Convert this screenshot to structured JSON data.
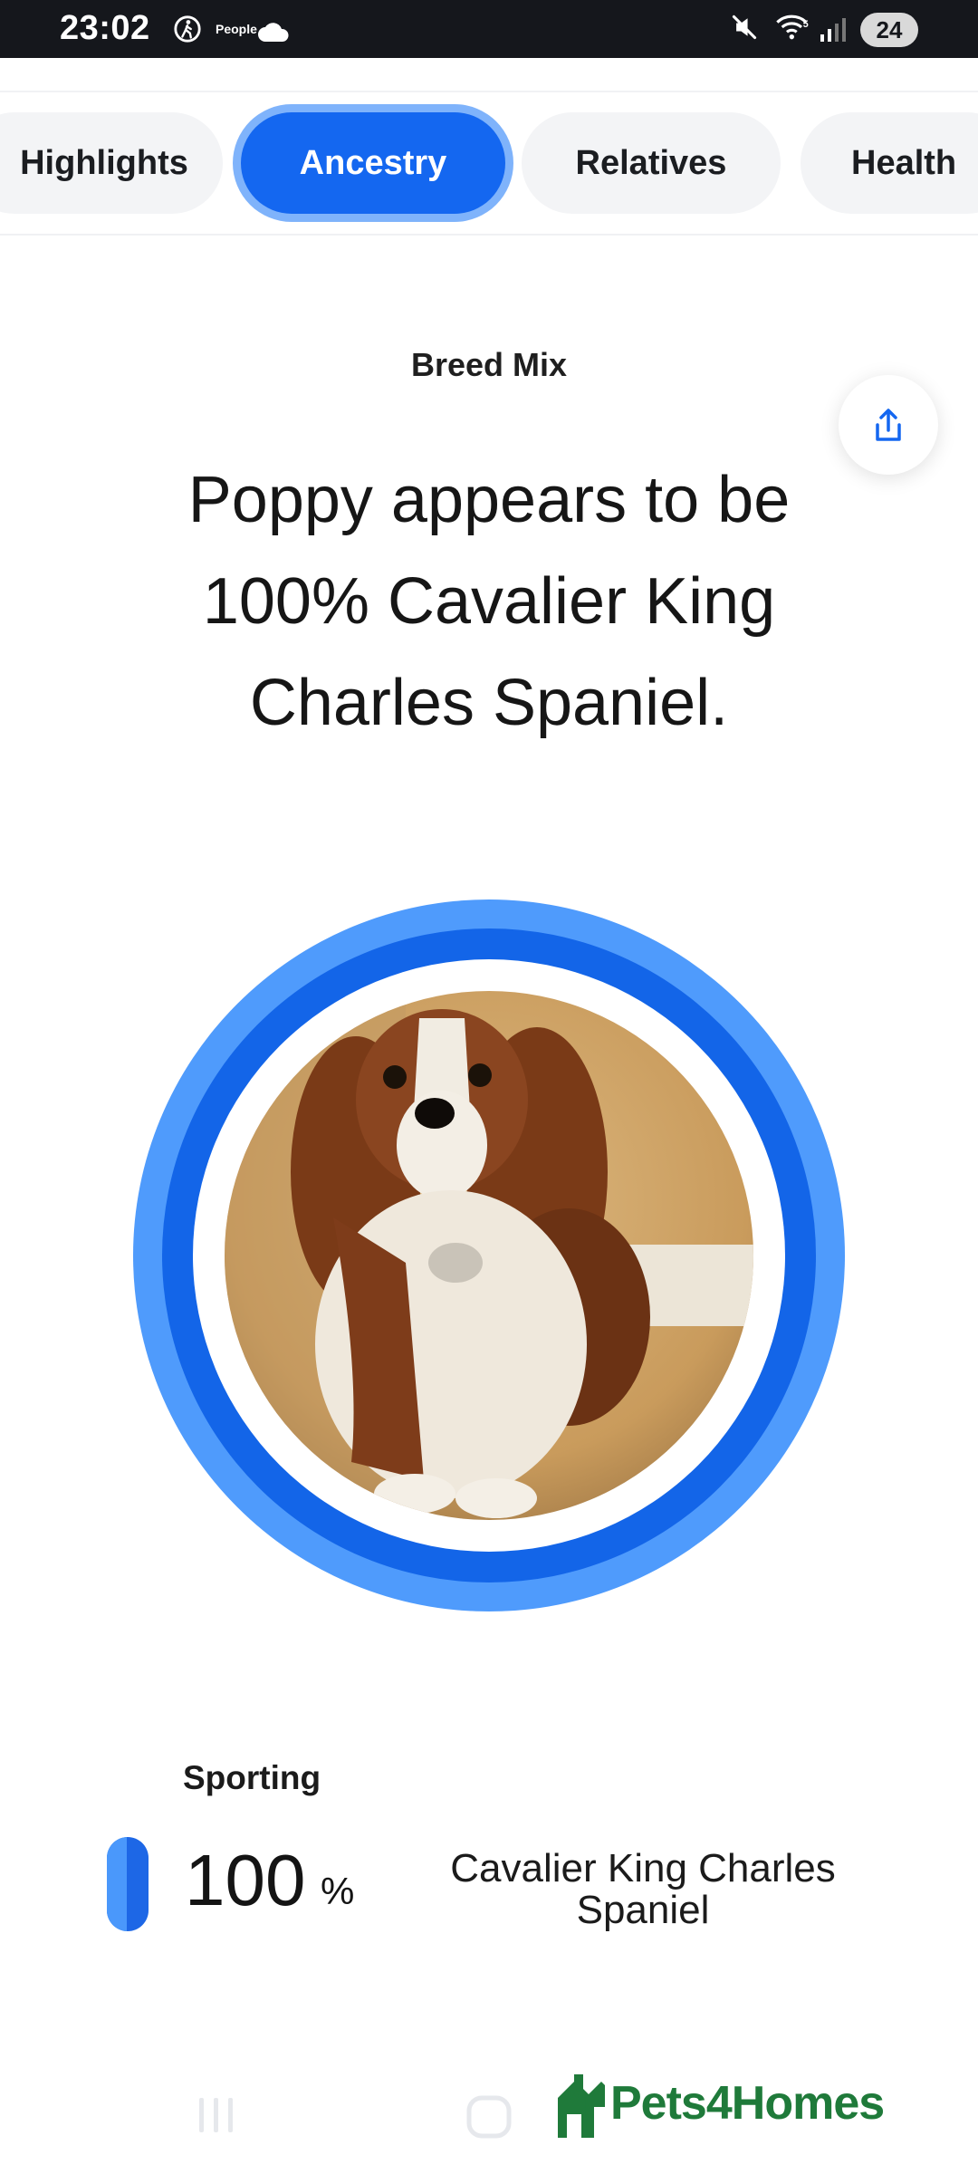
{
  "status_bar": {
    "time": "23:02",
    "people_label": "People",
    "battery": "24"
  },
  "tabs": [
    {
      "label": "Highlights",
      "active": false
    },
    {
      "label": "Ancestry",
      "active": true
    },
    {
      "label": "Relatives",
      "active": false
    },
    {
      "label": "Health",
      "active": false
    }
  ],
  "main": {
    "subtitle": "Breed Mix",
    "headline": "Poppy appears to be 100% Cavalier King Charles Spaniel.",
    "share_icon": "share-icon"
  },
  "breakdown": {
    "group": "Sporting",
    "percent_value": "100",
    "percent_symbol": "%",
    "breed": "Cavalier King Charles Spaniel"
  },
  "watermark": {
    "text": "Pets4Homes"
  },
  "colors": {
    "accent": "#1467f0",
    "accent_light": "#4f9bfc",
    "brand_green": "#1f7a3a"
  }
}
